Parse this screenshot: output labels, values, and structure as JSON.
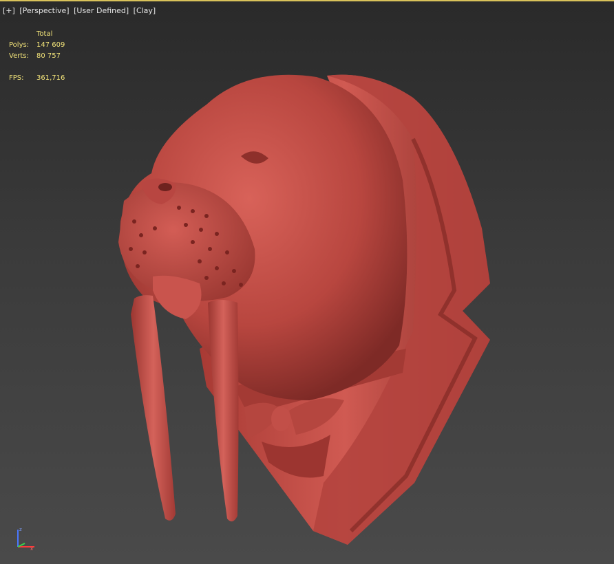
{
  "viewport": {
    "labels": [
      "[+]",
      "[Perspective]",
      "[User Defined]",
      "[Clay]"
    ],
    "stats": {
      "header": "Total",
      "polys_label": "Polys:",
      "polys_value": "147 609",
      "verts_label": "Verts:",
      "verts_value": "80 757",
      "fps_label": "FPS:",
      "fps_value": "361,716"
    },
    "axis_gizmo": {
      "z_label": "z",
      "x_label": "x",
      "colors": {
        "x": "#ff3b3b",
        "y": "#38d84a",
        "z": "#4a78ff"
      }
    },
    "clay_color": "#c8504a"
  }
}
